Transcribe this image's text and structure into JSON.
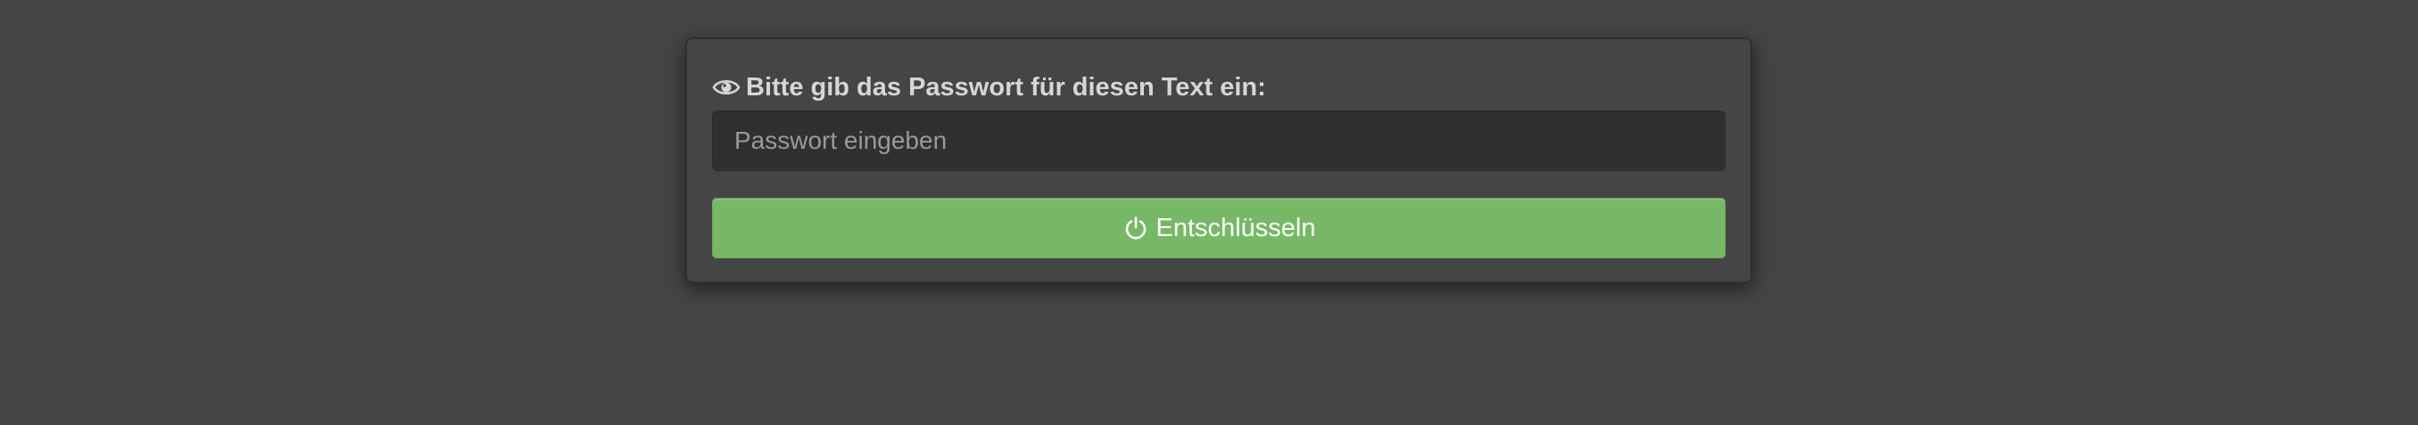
{
  "dialog": {
    "prompt_icon": "eye-icon",
    "prompt_text": "Bitte gib das Passwort für diesen Text ein:",
    "password_input": {
      "value": "",
      "placeholder": "Passwort eingeben"
    },
    "decrypt_button": {
      "icon": "power-icon",
      "label": "Entschlüsseln",
      "color": "#76b866"
    }
  },
  "colors": {
    "background": "#454545",
    "input_background": "#303030",
    "text": "#d6d6d6",
    "button_text": "#ffffff"
  }
}
